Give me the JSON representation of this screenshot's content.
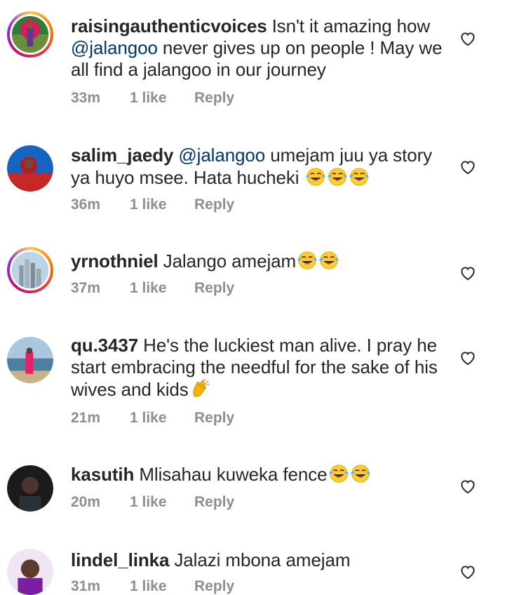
{
  "comments": [
    {
      "username": "raisingauthenticvoices",
      "pre": "Isn't it amazing how ",
      "mention": "@jalangoo",
      "post": " never gives up on people ! May we all find a jalangoo in our journey",
      "time": "33m",
      "likes": "1 like",
      "reply": "Reply",
      "emoji": []
    },
    {
      "username": "salim_jaedy",
      "pre": "",
      "mention": "@jalangoo",
      "post": " umejam juu ya story ya huyo msee. Hata hucheki ",
      "time": "36m",
      "likes": "1 like",
      "reply": "Reply",
      "emoji": [
        "laughing-tears",
        "laughing-tears",
        "laughing-tears"
      ]
    },
    {
      "username": "yrnothniel",
      "pre": "Jalango amejam",
      "mention": "",
      "post": "",
      "time": "37m",
      "likes": "1 like",
      "reply": "Reply",
      "emoji": [
        "laughing-tears",
        "laughing-tears"
      ]
    },
    {
      "username": "qu.3437",
      "pre": "He's the luckiest man alive. I pray he start embracing the needful for the sake of his wives and kids",
      "mention": "",
      "post": "",
      "time": "21m",
      "likes": "1 like",
      "reply": "Reply",
      "emoji": [
        "clapping-hands"
      ]
    },
    {
      "username": "kasutih",
      "pre": "Mlisahau kuweka fence",
      "mention": "",
      "post": "",
      "time": "20m",
      "likes": "1 like",
      "reply": "Reply",
      "emoji": [
        "laughing-tears",
        "laughing-tears"
      ]
    },
    {
      "username": "lindel_linka",
      "pre": "Jalazi mbona amejam",
      "mention": "",
      "post": "",
      "time": "31m",
      "likes": "1 like",
      "reply": "Reply",
      "emoji": []
    }
  ],
  "icons": {
    "like": "heart-outline-icon",
    "laugh": "face-with-tears-of-joy",
    "clap": "clapping-hands"
  },
  "colors": {
    "username": "#262626",
    "mention": "#00376b",
    "meta": "#8e8e8e",
    "heart": "#262626"
  }
}
